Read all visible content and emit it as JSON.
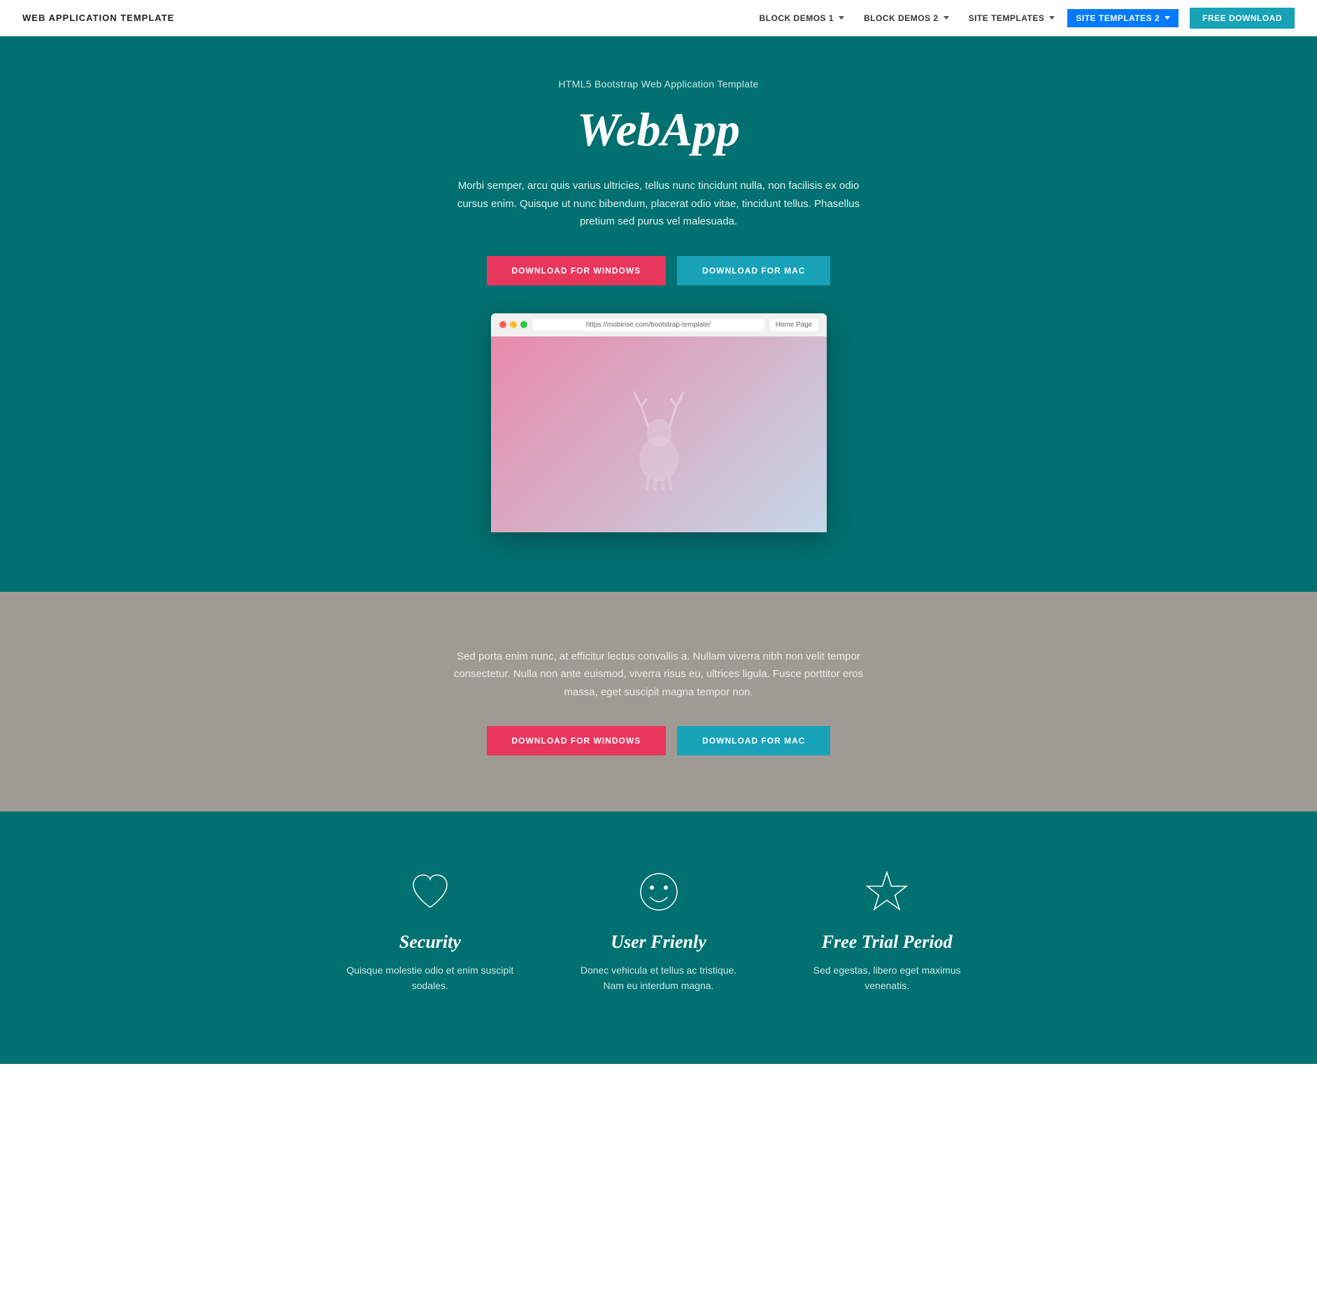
{
  "navbar": {
    "brand": "WEB APPLICATION TEMPLATE",
    "nav_items": [
      {
        "label": "BLOCK DEMOS 1",
        "has_dropdown": true
      },
      {
        "label": "BLOCK DEMOS 2",
        "has_dropdown": true
      },
      {
        "label": "SITE TEMPLATES",
        "has_dropdown": true
      }
    ],
    "selected_dropdown": "SITE TEMPLATES 2",
    "free_download_label": "FREE DOWNLOAD"
  },
  "hero": {
    "subtitle": "HTML5 Bootstrap Web Application Template",
    "title": "WebApp",
    "description": "Morbi semper, arcu quis varius ultricies, tellus nunc tincidunt nulla, non facilisis ex odio cursus enim. Quisque ut nunc bibendum, placerat odio vitae, tincidunt tellus. Phasellus pretium sed purus vel malesuada.",
    "btn_windows": "DOWNLOAD FOR WINDOWS",
    "btn_mac": "DOWNLOAD FOR MAC",
    "browser_url": "https://mobirise.com/bootstrap-template/",
    "browser_home": "Home Page"
  },
  "grey_section": {
    "description": "Sed porta enim nunc, at efficitur lectus convallis a. Nullam viverra nibh non velit tempor consectetur. Nulla non ante euismod, viverra risus eu, ultrices ligula. Fusce porttitor eros massa, eget suscipit magna tempor non.",
    "btn_windows": "DOWNLOAD FOR WINDOWS",
    "btn_mac": "DOWNLOAD FOR MAC"
  },
  "features": {
    "items": [
      {
        "icon": "heart",
        "title": "Security",
        "description": "Quisque molestie odio et enim suscipit sodales."
      },
      {
        "icon": "smiley",
        "title": "User Frienly",
        "description": "Donec vehicula et tellus ac tristique. Nam eu interdum magna."
      },
      {
        "icon": "star",
        "title": "Free Trial Period",
        "description": "Sed egestas, libero eget maximus venenatis."
      }
    ]
  }
}
